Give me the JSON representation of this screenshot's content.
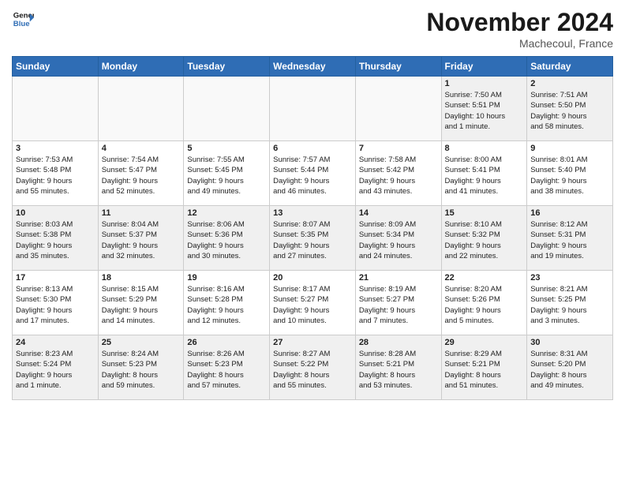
{
  "logo": {
    "line1": "General",
    "line2": "Blue"
  },
  "title": "November 2024",
  "location": "Machecoul, France",
  "weekdays": [
    "Sunday",
    "Monday",
    "Tuesday",
    "Wednesday",
    "Thursday",
    "Friday",
    "Saturday"
  ],
  "weeks": [
    [
      {
        "day": "",
        "info": ""
      },
      {
        "day": "",
        "info": ""
      },
      {
        "day": "",
        "info": ""
      },
      {
        "day": "",
        "info": ""
      },
      {
        "day": "",
        "info": ""
      },
      {
        "day": "1",
        "info": "Sunrise: 7:50 AM\nSunset: 5:51 PM\nDaylight: 10 hours\nand 1 minute."
      },
      {
        "day": "2",
        "info": "Sunrise: 7:51 AM\nSunset: 5:50 PM\nDaylight: 9 hours\nand 58 minutes."
      }
    ],
    [
      {
        "day": "3",
        "info": "Sunrise: 7:53 AM\nSunset: 5:48 PM\nDaylight: 9 hours\nand 55 minutes."
      },
      {
        "day": "4",
        "info": "Sunrise: 7:54 AM\nSunset: 5:47 PM\nDaylight: 9 hours\nand 52 minutes."
      },
      {
        "day": "5",
        "info": "Sunrise: 7:55 AM\nSunset: 5:45 PM\nDaylight: 9 hours\nand 49 minutes."
      },
      {
        "day": "6",
        "info": "Sunrise: 7:57 AM\nSunset: 5:44 PM\nDaylight: 9 hours\nand 46 minutes."
      },
      {
        "day": "7",
        "info": "Sunrise: 7:58 AM\nSunset: 5:42 PM\nDaylight: 9 hours\nand 43 minutes."
      },
      {
        "day": "8",
        "info": "Sunrise: 8:00 AM\nSunset: 5:41 PM\nDaylight: 9 hours\nand 41 minutes."
      },
      {
        "day": "9",
        "info": "Sunrise: 8:01 AM\nSunset: 5:40 PM\nDaylight: 9 hours\nand 38 minutes."
      }
    ],
    [
      {
        "day": "10",
        "info": "Sunrise: 8:03 AM\nSunset: 5:38 PM\nDaylight: 9 hours\nand 35 minutes."
      },
      {
        "day": "11",
        "info": "Sunrise: 8:04 AM\nSunset: 5:37 PM\nDaylight: 9 hours\nand 32 minutes."
      },
      {
        "day": "12",
        "info": "Sunrise: 8:06 AM\nSunset: 5:36 PM\nDaylight: 9 hours\nand 30 minutes."
      },
      {
        "day": "13",
        "info": "Sunrise: 8:07 AM\nSunset: 5:35 PM\nDaylight: 9 hours\nand 27 minutes."
      },
      {
        "day": "14",
        "info": "Sunrise: 8:09 AM\nSunset: 5:34 PM\nDaylight: 9 hours\nand 24 minutes."
      },
      {
        "day": "15",
        "info": "Sunrise: 8:10 AM\nSunset: 5:32 PM\nDaylight: 9 hours\nand 22 minutes."
      },
      {
        "day": "16",
        "info": "Sunrise: 8:12 AM\nSunset: 5:31 PM\nDaylight: 9 hours\nand 19 minutes."
      }
    ],
    [
      {
        "day": "17",
        "info": "Sunrise: 8:13 AM\nSunset: 5:30 PM\nDaylight: 9 hours\nand 17 minutes."
      },
      {
        "day": "18",
        "info": "Sunrise: 8:15 AM\nSunset: 5:29 PM\nDaylight: 9 hours\nand 14 minutes."
      },
      {
        "day": "19",
        "info": "Sunrise: 8:16 AM\nSunset: 5:28 PM\nDaylight: 9 hours\nand 12 minutes."
      },
      {
        "day": "20",
        "info": "Sunrise: 8:17 AM\nSunset: 5:27 PM\nDaylight: 9 hours\nand 10 minutes."
      },
      {
        "day": "21",
        "info": "Sunrise: 8:19 AM\nSunset: 5:27 PM\nDaylight: 9 hours\nand 7 minutes."
      },
      {
        "day": "22",
        "info": "Sunrise: 8:20 AM\nSunset: 5:26 PM\nDaylight: 9 hours\nand 5 minutes."
      },
      {
        "day": "23",
        "info": "Sunrise: 8:21 AM\nSunset: 5:25 PM\nDaylight: 9 hours\nand 3 minutes."
      }
    ],
    [
      {
        "day": "24",
        "info": "Sunrise: 8:23 AM\nSunset: 5:24 PM\nDaylight: 9 hours\nand 1 minute."
      },
      {
        "day": "25",
        "info": "Sunrise: 8:24 AM\nSunset: 5:23 PM\nDaylight: 8 hours\nand 59 minutes."
      },
      {
        "day": "26",
        "info": "Sunrise: 8:26 AM\nSunset: 5:23 PM\nDaylight: 8 hours\nand 57 minutes."
      },
      {
        "day": "27",
        "info": "Sunrise: 8:27 AM\nSunset: 5:22 PM\nDaylight: 8 hours\nand 55 minutes."
      },
      {
        "day": "28",
        "info": "Sunrise: 8:28 AM\nSunset: 5:21 PM\nDaylight: 8 hours\nand 53 minutes."
      },
      {
        "day": "29",
        "info": "Sunrise: 8:29 AM\nSunset: 5:21 PM\nDaylight: 8 hours\nand 51 minutes."
      },
      {
        "day": "30",
        "info": "Sunrise: 8:31 AM\nSunset: 5:20 PM\nDaylight: 8 hours\nand 49 minutes."
      }
    ]
  ]
}
